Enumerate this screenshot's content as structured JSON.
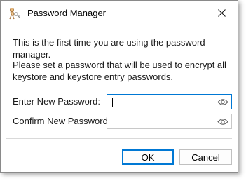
{
  "window": {
    "title": "Password Manager",
    "icon": "key-figure-icon",
    "close_icon": "close-icon"
  },
  "messages": {
    "first_time": "This is the first time you are using the password manager.",
    "instructions": "Please set a password that will be used to encrypt all keystore and keystore entry passwords."
  },
  "fields": {
    "new_password": {
      "label": "Enter New Password:",
      "value": "",
      "icon": "eye-icon"
    },
    "confirm_password": {
      "label": "Confirm New Password:",
      "value": "",
      "icon": "eye-icon"
    }
  },
  "buttons": {
    "ok": "OK",
    "cancel": "Cancel"
  },
  "colors": {
    "accent": "#0078d4",
    "border": "#c8c8c8"
  }
}
